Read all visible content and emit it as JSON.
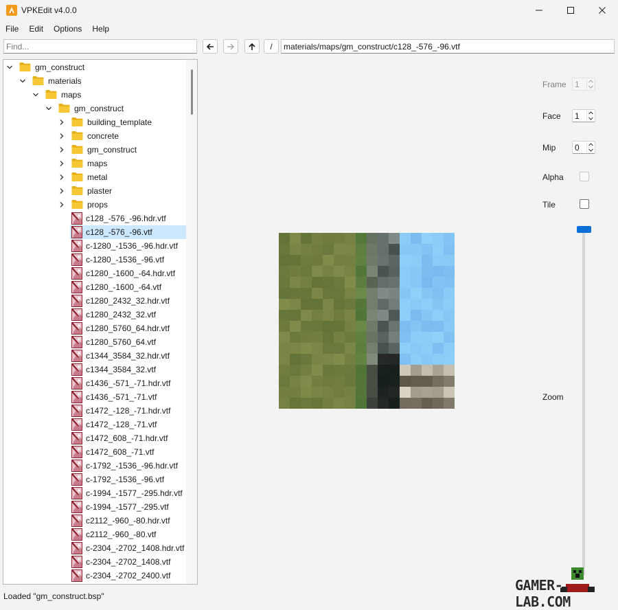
{
  "window": {
    "title": "VPKEdit v4.0.0"
  },
  "menu": [
    "File",
    "Edit",
    "Options",
    "Help"
  ],
  "search": {
    "placeholder": "Find...",
    "value": ""
  },
  "path_bar": {
    "path": "materials/maps/gm_construct/c128_-576_-96.vtf",
    "root_label": "/"
  },
  "tree": {
    "root": "gm_construct",
    "folders": [
      "materials",
      "maps",
      "gm_construct"
    ],
    "subfolders": [
      "building_template",
      "concrete",
      "gm_construct",
      "maps",
      "metal",
      "plaster",
      "props"
    ],
    "files": [
      "c128_-576_-96.hdr.vtf",
      "c128_-576_-96.vtf",
      "c-1280_-1536_-96.hdr.vtf",
      "c-1280_-1536_-96.vtf",
      "c1280_-1600_-64.hdr.vtf",
      "c1280_-1600_-64.vtf",
      "c1280_2432_32.hdr.vtf",
      "c1280_2432_32.vtf",
      "c1280_5760_64.hdr.vtf",
      "c1280_5760_64.vtf",
      "c1344_3584_32.hdr.vtf",
      "c1344_3584_32.vtf",
      "c1436_-571_-71.hdr.vtf",
      "c1436_-571_-71.vtf",
      "c1472_-128_-71.hdr.vtf",
      "c1472_-128_-71.vtf",
      "c1472_608_-71.hdr.vtf",
      "c1472_608_-71.vtf",
      "c-1792_-1536_-96.hdr.vtf",
      "c-1792_-1536_-96.vtf",
      "c-1994_-1577_-295.hdr.vtf",
      "c-1994_-1577_-295.vtf",
      "c2112_-960_-80.hdr.vtf",
      "c2112_-960_-80.vtf",
      "c-2304_-2702_1408.hdr.vtf",
      "c-2304_-2702_1408.vtf",
      "c-2304_-2702_2400.vtf"
    ],
    "selected_file": "c128_-576_-96.vtf"
  },
  "controls": {
    "frame": {
      "label": "Frame",
      "value": "1",
      "enabled": false
    },
    "face": {
      "label": "Face",
      "value": "1",
      "enabled": true
    },
    "mip": {
      "label": "Mip",
      "value": "0",
      "enabled": true
    },
    "alpha": {
      "label": "Alpha",
      "checked": false,
      "enabled": false
    },
    "tile": {
      "label": "Tile",
      "checked": false,
      "enabled": true
    },
    "zoom": {
      "label": "Zoom",
      "level": 1.0
    }
  },
  "status": "Loaded \"gm_construct.bsp\"",
  "watermark": "GAMER-LAB.COM",
  "colors": {
    "accent": "#0a6fd6",
    "selection": "#cce8ff",
    "folder": "#f8c736"
  }
}
